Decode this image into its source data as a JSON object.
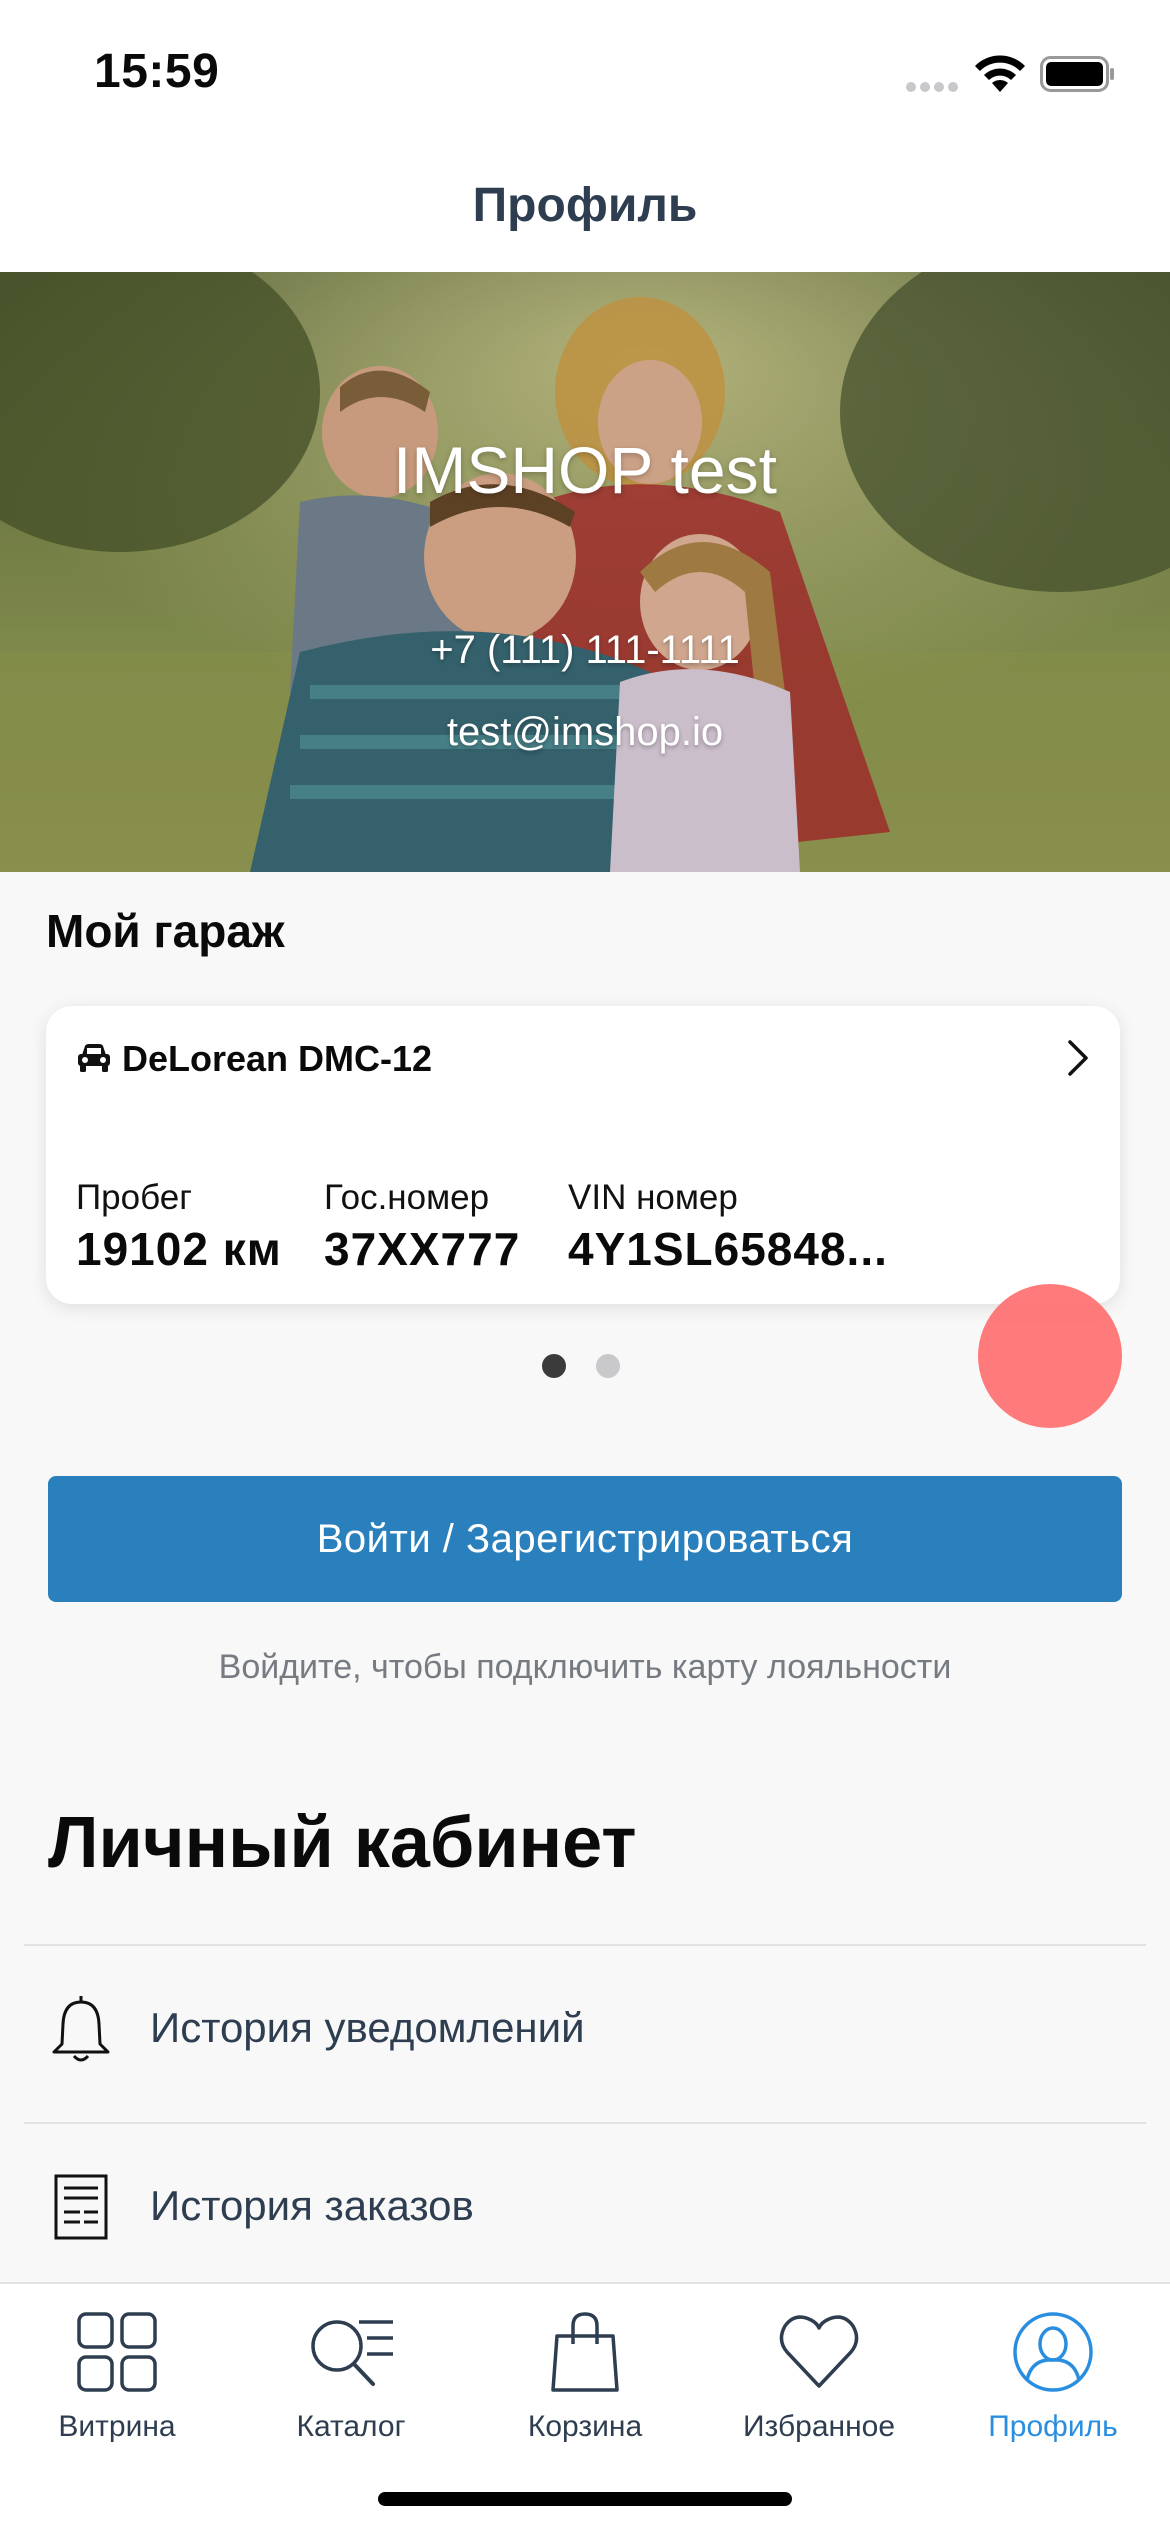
{
  "status_bar": {
    "time": "15:59",
    "icons": [
      "signal-dots-icon",
      "wifi-icon",
      "battery-icon"
    ]
  },
  "nav": {
    "title": "Профиль"
  },
  "profile": {
    "name": "IMSHOP test",
    "phone": "+7 (111) 111-1111",
    "email": "test@imshop.io"
  },
  "garage": {
    "title": "Мой гараж",
    "cars": [
      {
        "icon": "car-icon",
        "name": "DeLorean DMC-12",
        "mileage_label": "Пробег",
        "mileage_value": "19102 км",
        "plate_label": "Гос.номер",
        "plate_value": "37XX777",
        "vin_label": "VIN номер",
        "vin_value": "4Y1SL65848..."
      }
    ],
    "page_count": 2,
    "current_page": 1
  },
  "auth": {
    "button_label": "Войти / Зарегистрироваться",
    "hint": "Войдите, чтобы подключить карту лояльности"
  },
  "cabinet": {
    "title": "Личный кабинет",
    "items": [
      {
        "icon": "bell-icon",
        "label": "История уведомлений"
      },
      {
        "icon": "receipt-icon",
        "label": "История заказов"
      }
    ]
  },
  "tabbar": {
    "items": [
      {
        "icon": "grid-icon",
        "label": "Витрина",
        "active": false
      },
      {
        "icon": "search-list-icon",
        "label": "Каталог",
        "active": false
      },
      {
        "icon": "bag-icon",
        "label": "Корзина",
        "active": false
      },
      {
        "icon": "heart-icon",
        "label": "Избранное",
        "active": false
      },
      {
        "icon": "user-icon",
        "label": "Профиль",
        "active": true
      }
    ]
  },
  "colors": {
    "accent": "#2a80bd",
    "tab_active": "#2a8ee0",
    "text_dark": "#2e3e50",
    "hint": "#767b82",
    "touch_indicator": "#ff6969"
  }
}
